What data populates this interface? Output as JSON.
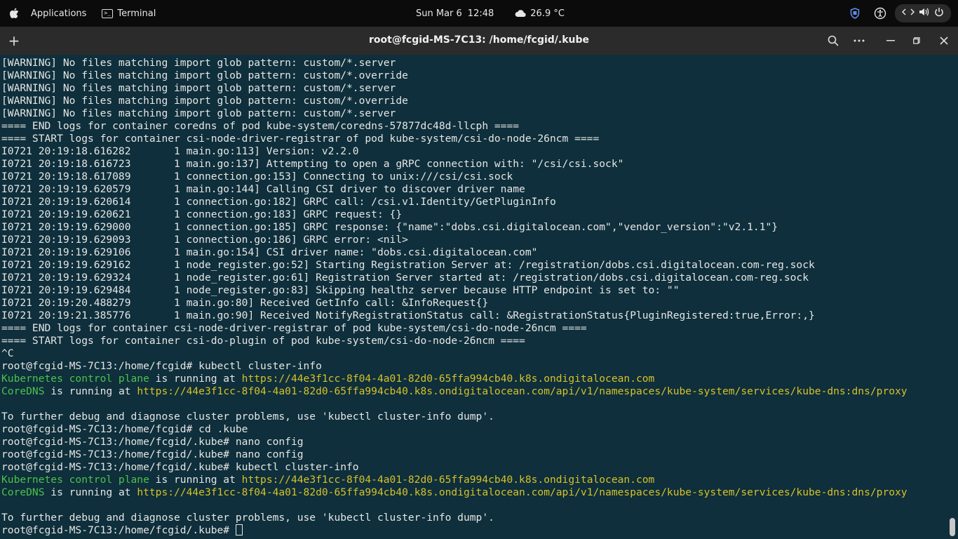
{
  "topbar": {
    "applications_label": "Applications",
    "app_label": "Terminal",
    "date": "Sun Mar 6",
    "time": "12:48",
    "weather_temp": "26.9 °C"
  },
  "window": {
    "title": "root@fcgid-MS-7C13: /home/fcgid/.kube"
  },
  "terminal": {
    "lines": [
      {
        "parts": [
          {
            "t": "[WARNING] No files matching import glob pattern: custom/*.server"
          }
        ]
      },
      {
        "parts": [
          {
            "t": "[WARNING] No files matching import glob pattern: custom/*.override"
          }
        ]
      },
      {
        "parts": [
          {
            "t": "[WARNING] No files matching import glob pattern: custom/*.server"
          }
        ]
      },
      {
        "parts": [
          {
            "t": "[WARNING] No files matching import glob pattern: custom/*.override"
          }
        ]
      },
      {
        "parts": [
          {
            "t": "[WARNING] No files matching import glob pattern: custom/*.server"
          }
        ]
      },
      {
        "parts": [
          {
            "t": "==== END logs for container coredns of pod kube-system/coredns-57877dc48d-llcph ===="
          }
        ]
      },
      {
        "parts": [
          {
            "t": "==== START logs for container csi-node-driver-registrar of pod kube-system/csi-do-node-26ncm ===="
          }
        ]
      },
      {
        "parts": [
          {
            "t": "I0721 20:19:18.616282       1 main.go:113] Version: v2.2.0"
          }
        ]
      },
      {
        "parts": [
          {
            "t": "I0721 20:19:18.616723       1 main.go:137] Attempting to open a gRPC connection with: \"/csi/csi.sock\""
          }
        ]
      },
      {
        "parts": [
          {
            "t": "I0721 20:19:18.617089       1 connection.go:153] Connecting to unix:///csi/csi.sock"
          }
        ]
      },
      {
        "parts": [
          {
            "t": "I0721 20:19:19.620579       1 main.go:144] Calling CSI driver to discover driver name"
          }
        ]
      },
      {
        "parts": [
          {
            "t": "I0721 20:19:19.620614       1 connection.go:182] GRPC call: /csi.v1.Identity/GetPluginInfo"
          }
        ]
      },
      {
        "parts": [
          {
            "t": "I0721 20:19:19.620621       1 connection.go:183] GRPC request: {}"
          }
        ]
      },
      {
        "parts": [
          {
            "t": "I0721 20:19:19.629000       1 connection.go:185] GRPC response: {\"name\":\"dobs.csi.digitalocean.com\",\"vendor_version\":\"v2.1.1\"}"
          }
        ]
      },
      {
        "parts": [
          {
            "t": "I0721 20:19:19.629093       1 connection.go:186] GRPC error: <nil>"
          }
        ]
      },
      {
        "parts": [
          {
            "t": "I0721 20:19:19.629106       1 main.go:154] CSI driver name: \"dobs.csi.digitalocean.com\""
          }
        ]
      },
      {
        "parts": [
          {
            "t": "I0721 20:19:19.629162       1 node_register.go:52] Starting Registration Server at: /registration/dobs.csi.digitalocean.com-reg.sock"
          }
        ]
      },
      {
        "parts": [
          {
            "t": "I0721 20:19:19.629324       1 node_register.go:61] Registration Server started at: /registration/dobs.csi.digitalocean.com-reg.sock"
          }
        ]
      },
      {
        "parts": [
          {
            "t": "I0721 20:19:19.629484       1 node_register.go:83] Skipping healthz server because HTTP endpoint is set to: \"\""
          }
        ]
      },
      {
        "parts": [
          {
            "t": "I0721 20:19:20.488279       1 main.go:80] Received GetInfo call: &InfoRequest{}"
          }
        ]
      },
      {
        "parts": [
          {
            "t": "I0721 20:19:21.385776       1 main.go:90] Received NotifyRegistrationStatus call: &RegistrationStatus{PluginRegistered:true,Error:,}"
          }
        ]
      },
      {
        "parts": [
          {
            "t": "==== END logs for container csi-node-driver-registrar of pod kube-system/csi-do-node-26ncm ===="
          }
        ]
      },
      {
        "parts": [
          {
            "t": "==== START logs for container csi-do-plugin of pod kube-system/csi-do-node-26ncm ===="
          }
        ]
      },
      {
        "parts": [
          {
            "t": "^C"
          }
        ]
      },
      {
        "parts": [
          {
            "t": "root@fcgid-MS-7C13:/home/fcgid# kubectl cluster-info"
          }
        ]
      },
      {
        "parts": [
          {
            "t": "Kubernetes control plane",
            "c": "g"
          },
          {
            "t": " is running at "
          },
          {
            "t": "https://44e3f1cc-8f04-4a01-82d0-65ffa994cb40.k8s.ondigitalocean.com",
            "c": "y"
          }
        ]
      },
      {
        "parts": [
          {
            "t": "CoreDNS",
            "c": "g"
          },
          {
            "t": " is running at "
          },
          {
            "t": "https://44e3f1cc-8f04-4a01-82d0-65ffa994cb40.k8s.ondigitalocean.com/api/v1/namespaces/kube-system/services/kube-dns:dns/proxy",
            "c": "y"
          }
        ]
      },
      {
        "parts": [
          {
            "t": ""
          }
        ]
      },
      {
        "parts": [
          {
            "t": "To further debug and diagnose cluster problems, use 'kubectl cluster-info dump'."
          }
        ]
      },
      {
        "parts": [
          {
            "t": "root@fcgid-MS-7C13:/home/fcgid# cd .kube"
          }
        ]
      },
      {
        "parts": [
          {
            "t": "root@fcgid-MS-7C13:/home/fcgid/.kube# nano config"
          }
        ]
      },
      {
        "parts": [
          {
            "t": "root@fcgid-MS-7C13:/home/fcgid/.kube# nano config"
          }
        ]
      },
      {
        "parts": [
          {
            "t": "root@fcgid-MS-7C13:/home/fcgid/.kube# kubectl cluster-info"
          }
        ]
      },
      {
        "parts": [
          {
            "t": "Kubernetes control plane",
            "c": "g"
          },
          {
            "t": " is running at "
          },
          {
            "t": "https://44e3f1cc-8f04-4a01-82d0-65ffa994cb40.k8s.ondigitalocean.com",
            "c": "y"
          }
        ]
      },
      {
        "parts": [
          {
            "t": "CoreDNS",
            "c": "g"
          },
          {
            "t": " is running at "
          },
          {
            "t": "https://44e3f1cc-8f04-4a01-82d0-65ffa994cb40.k8s.ondigitalocean.com/api/v1/namespaces/kube-system/services/kube-dns:dns/proxy",
            "c": "y"
          }
        ]
      },
      {
        "parts": [
          {
            "t": ""
          }
        ]
      },
      {
        "parts": [
          {
            "t": "To further debug and diagnose cluster problems, use 'kubectl cluster-info dump'."
          }
        ]
      }
    ],
    "prompt": "root@fcgid-MS-7C13:/home/fcgid/.kube# "
  },
  "colors": {
    "background": "#0e2f3b",
    "green": "#4ec14e",
    "yellow": "#d7c12a"
  }
}
